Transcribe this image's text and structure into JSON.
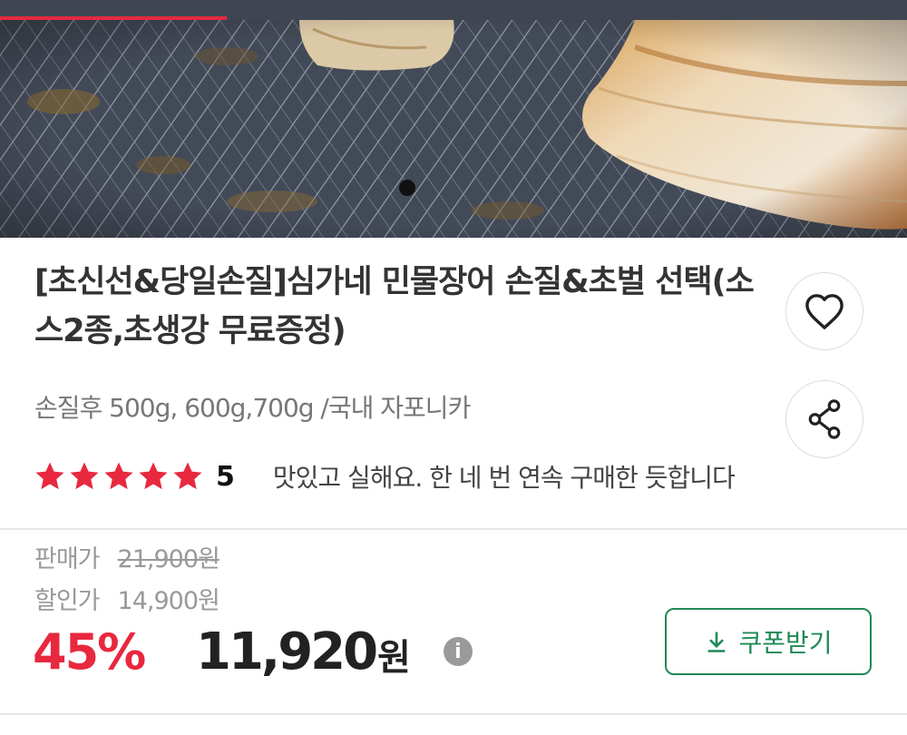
{
  "colors": {
    "accent_red": "#e8283f",
    "coupon_green": "#1f8a55",
    "muted_text": "#777777",
    "border": "#dcdcdc"
  },
  "gallery": {
    "indicator_dots": 1,
    "image_alt": "grilled eel on a griddle pan"
  },
  "product": {
    "title": "[초신선&당일손질]심가네 민물장어 손질&초벌 선택(소스2종,초생강 무료증정)",
    "subtitle": "손질후 500g, 600g,700g /국내 자포니카"
  },
  "actions": {
    "wish_icon": "heart-icon",
    "share_icon": "share-icon"
  },
  "rating": {
    "stars": 5,
    "score": "5",
    "review_snippet": "맛있고 실해요. 한 네 번 연속 구매한 듯합니다"
  },
  "price": {
    "original_label": "판매가",
    "original_value": "21,900원",
    "discount_label": "할인가",
    "discount_value": "14,900원",
    "discount_rate": "45%",
    "final_value": "11,920",
    "final_unit": "원",
    "info_icon": "info-icon"
  },
  "coupon": {
    "label": "쿠폰받기",
    "icon": "download-icon"
  }
}
